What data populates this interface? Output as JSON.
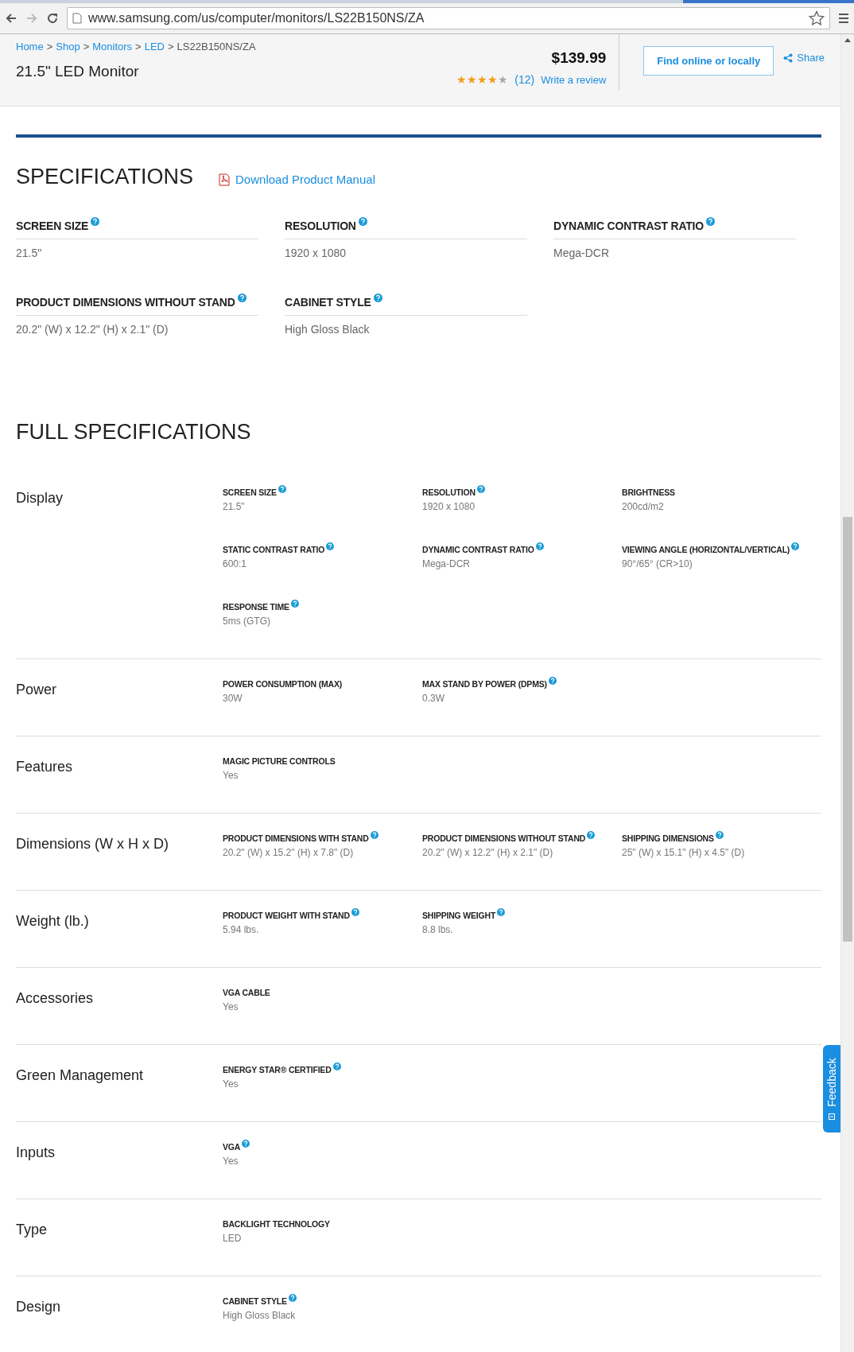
{
  "browser": {
    "url": "www.samsung.com/us/computer/monitors/LS22B150NS/ZA"
  },
  "product": {
    "breadcrumb": [
      {
        "label": "Home",
        "kind": "link"
      },
      {
        "label": "Shop",
        "kind": "link"
      },
      {
        "label": "Monitors",
        "kind": "link"
      },
      {
        "label": "LED",
        "kind": "link"
      },
      {
        "label": "LS22B150NS/ZA",
        "kind": "current"
      }
    ],
    "separator": ">",
    "title": "21.5\" LED Monitor",
    "price": "$139.99",
    "stars": 4,
    "review_count": "(12)",
    "write_review": "Write a review",
    "find_button": "Find online or locally",
    "share": "Share"
  },
  "specifications": {
    "title": "SPECIFICATIONS",
    "manual_link": "Download Product Manual",
    "items": [
      {
        "label": "SCREEN SIZE",
        "value": "21.5\"",
        "help": true
      },
      {
        "label": "RESOLUTION",
        "value": "1920 x 1080",
        "help": true
      },
      {
        "label": "DYNAMIC CONTRAST RATIO",
        "value": "Mega-DCR",
        "help": true
      },
      {
        "label": "PRODUCT DIMENSIONS WITHOUT STAND",
        "value": "20.2\" (W) x 12.2\" (H) x 2.1\" (D)",
        "help": true
      },
      {
        "label": "CABINET STYLE",
        "value": "High Gloss Black",
        "help": true
      }
    ]
  },
  "full_specifications": {
    "title": "FULL SPECIFICATIONS",
    "groups": [
      {
        "category": "Display",
        "items": [
          {
            "label": "SCREEN SIZE",
            "value": "21.5\"",
            "help": true
          },
          {
            "label": "RESOLUTION",
            "value": "1920 x 1080",
            "help": true
          },
          {
            "label": "BRIGHTNESS",
            "value": "200cd/m2",
            "help": false
          },
          {
            "label": "STATIC CONTRAST RATIO",
            "value": "600:1",
            "help": true
          },
          {
            "label": "DYNAMIC CONTRAST RATIO",
            "value": "Mega-DCR",
            "help": true
          },
          {
            "label": "VIEWING ANGLE (HORIZONTAL/VERTICAL)",
            "value": "90°/65° (CR>10)",
            "help": true
          },
          {
            "label": "RESPONSE TIME",
            "value": "5ms (GTG)",
            "help": true
          }
        ]
      },
      {
        "category": "Power",
        "items": [
          {
            "label": "POWER CONSUMPTION (MAX)",
            "value": "30W",
            "help": false
          },
          {
            "label": "MAX STAND BY POWER (DPMS)",
            "value": "0.3W",
            "help": true
          }
        ]
      },
      {
        "category": "Features",
        "items": [
          {
            "label": "MAGIC PICTURE CONTROLS",
            "value": "Yes",
            "help": false
          }
        ]
      },
      {
        "category": "Dimensions (W x H x D)",
        "items": [
          {
            "label": "PRODUCT DIMENSIONS WITH STAND",
            "value": "20.2\" (W) x 15.2\" (H) x 7.8\" (D)",
            "help": true
          },
          {
            "label": "PRODUCT DIMENSIONS WITHOUT STAND",
            "value": "20.2\" (W) x 12.2\" (H) x 2.1\" (D)",
            "help": true
          },
          {
            "label": "SHIPPING DIMENSIONS",
            "value": "25\" (W) x 15.1\" (H) x 4.5\" (D)",
            "help": true
          }
        ]
      },
      {
        "category": "Weight (lb.)",
        "items": [
          {
            "label": "PRODUCT WEIGHT WITH STAND",
            "value": "5.94 lbs.",
            "help": true
          },
          {
            "label": "SHIPPING WEIGHT",
            "value": "8.8 lbs.",
            "help": true
          }
        ]
      },
      {
        "category": "Accessories",
        "items": [
          {
            "label": "VGA CABLE",
            "value": "Yes",
            "help": false
          }
        ]
      },
      {
        "category": "Green Management",
        "items": [
          {
            "label": "ENERGY STAR® CERTIFIED",
            "value": "Yes",
            "help": true
          }
        ]
      },
      {
        "category": "Inputs",
        "items": [
          {
            "label": "VGA",
            "value": "Yes",
            "help": true
          }
        ]
      },
      {
        "category": "Type",
        "items": [
          {
            "label": "BACKLIGHT TECHNOLOGY",
            "value": "LED",
            "help": false
          }
        ]
      },
      {
        "category": "Design",
        "items": [
          {
            "label": "CABINET STYLE",
            "value": "High Gloss Black",
            "help": true
          }
        ]
      }
    ]
  },
  "feedback": {
    "label": "Feedback"
  }
}
